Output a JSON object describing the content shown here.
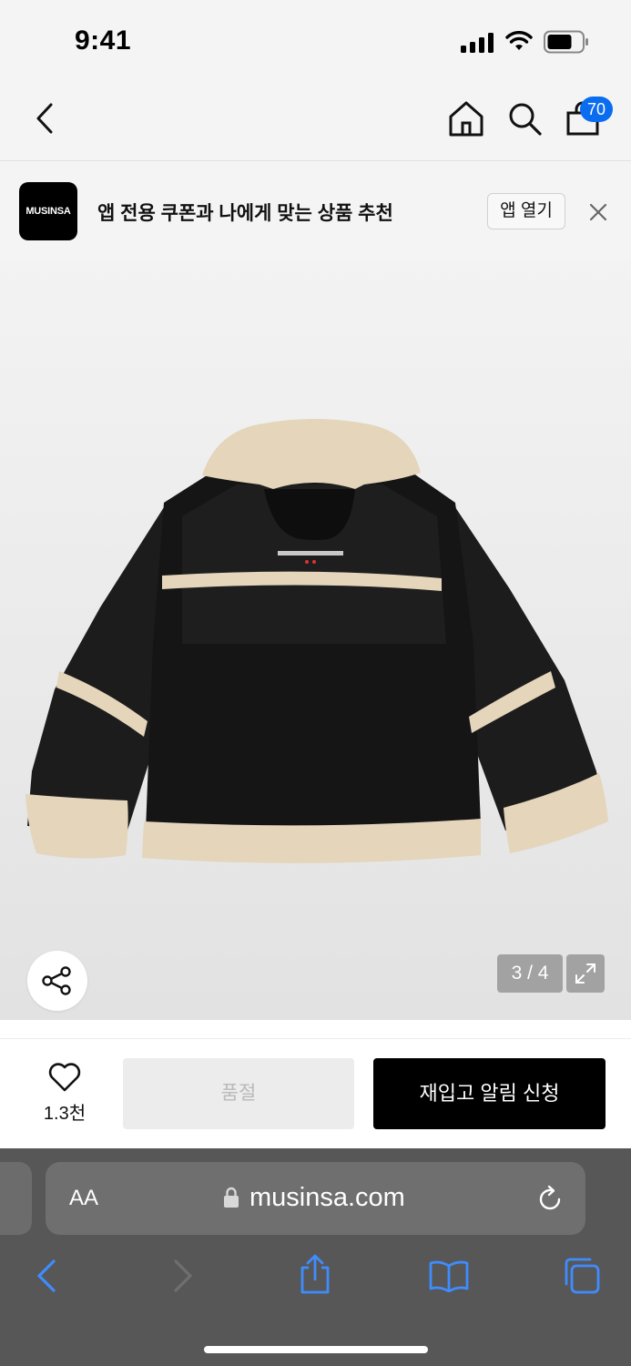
{
  "status_bar": {
    "time": "9:41"
  },
  "header": {
    "back_icon": "chevron-left-icon",
    "home_icon": "home-icon",
    "search_icon": "search-icon",
    "cart_icon": "shopping-bag-icon",
    "cart_count": "70"
  },
  "app_banner": {
    "logo_text": "MUSINSA",
    "text": "앱 전용 쿠폰과 나에게 맞는 상품 추천",
    "open_label": "앱 열기",
    "close_icon": "close-icon"
  },
  "product_image": {
    "alt": "black shearling jacket back view",
    "page_counter": "3 / 4",
    "share_icon": "share-icon",
    "expand_icon": "expand-icon"
  },
  "action_bar": {
    "like_icon": "heart-icon",
    "like_count": "1.3천",
    "soldout_label": "품절",
    "restock_label": "재입고 알림 신청"
  },
  "safari": {
    "aa_label": "AA",
    "url": "musinsa.com",
    "lock_icon": "lock-icon",
    "reload_icon": "reload-icon",
    "back_icon": "back-icon",
    "forward_icon": "forward-icon",
    "share_icon": "share-up-icon",
    "bookmarks_icon": "book-icon",
    "tabs_icon": "tabs-icon"
  },
  "colors": {
    "accent_blue": "#0a6df0",
    "primary_button": "#000000",
    "disabled_button": "#ececec",
    "safari_toolbar": "#575757"
  }
}
